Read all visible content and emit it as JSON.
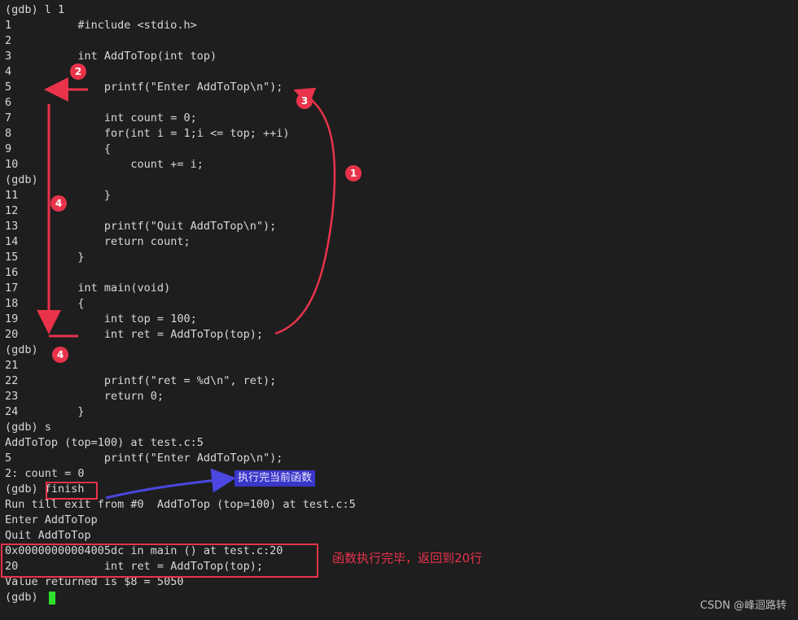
{
  "terminal": {
    "lines": [
      "(gdb) l 1",
      "1          #include <stdio.h>",
      "2",
      "3          int AddToTop(int top)",
      "4          {",
      "5              printf(\"Enter AddToTop\\n\");",
      "6",
      "7              int count = 0;",
      "8              for(int i = 1;i <= top; ++i)",
      "9              {",
      "10                 count += i;",
      "(gdb)",
      "11             }",
      "12",
      "13             printf(\"Quit AddToTop\\n\");",
      "14             return count;",
      "15         }",
      "16",
      "17         int main(void)",
      "18         {",
      "19             int top = 100;",
      "20             int ret = AddToTop(top);",
      "(gdb)",
      "21",
      "22             printf(\"ret = %d\\n\", ret);",
      "23             return 0;",
      "24         }",
      "(gdb) s",
      "AddToTop (top=100) at test.c:5",
      "5              printf(\"Enter AddToTop\\n\");",
      "2: count = 0",
      "(gdb) finish",
      "Run till exit from #0  AddToTop (top=100) at test.c:5",
      "Enter AddToTop",
      "Quit AddToTop",
      "0x00000000004005dc in main () at test.c:20",
      "20             int ret = AddToTop(top);",
      "Value returned is $8 = 5050",
      "(gdb) "
    ]
  },
  "annotations": {
    "badges": [
      "2",
      "3",
      "1",
      "4"
    ],
    "blue_note": "执行完当前函数",
    "red_note": "函数执行完毕，返回到20行"
  },
  "colors": {
    "background": "#1e1e1e",
    "text": "#d8d8d8",
    "annotation_red": "#e8334a",
    "annotation_blue": "#3a36c8",
    "cursor": "#2ee02e"
  },
  "watermark": "CSDN @峰迴路转"
}
